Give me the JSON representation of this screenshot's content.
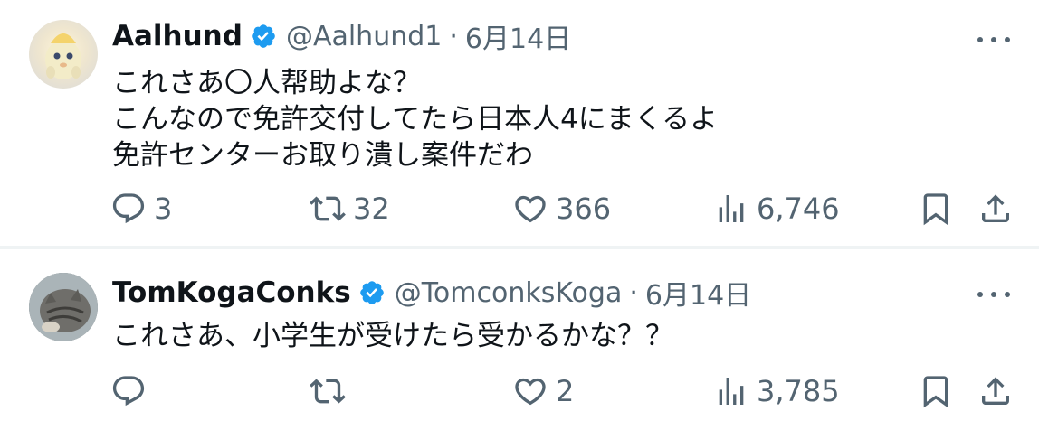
{
  "tweets": [
    {
      "display_name": "Aalhund",
      "handle": "@Aalhund1",
      "separator": "·",
      "date": "6月14日",
      "text": "これさあ〇人帮助よな？\nこんなので免許交付してたら日本人4にまくるよ\n免許センターお取り潰し案件だわ",
      "replies": "3",
      "retweets": "32",
      "likes": "366",
      "views": "6,746"
    },
    {
      "display_name": "TomKogaConks",
      "handle": "@TomconksKoga",
      "separator": "·",
      "date": "6月14日",
      "text": "これさあ、小学生が受けたら受かるかな？？",
      "replies": "",
      "retweets": "",
      "likes": "2",
      "views": "3,785"
    }
  ],
  "colors": {
    "verified": "#1d9bf0",
    "text_primary": "#0f1419",
    "text_secondary": "#536471",
    "divider": "#eff3f4"
  },
  "icons": [
    "verified-badge-icon",
    "more-icon",
    "reply-icon",
    "retweet-icon",
    "like-icon",
    "views-icon",
    "bookmark-icon",
    "share-icon"
  ]
}
